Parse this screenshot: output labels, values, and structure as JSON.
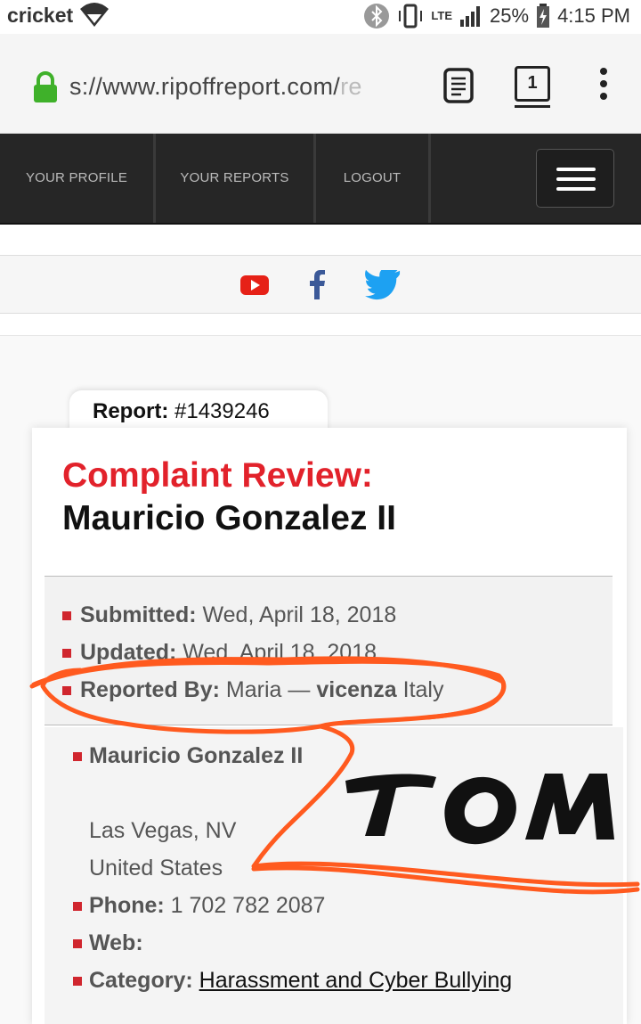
{
  "status_bar": {
    "carrier": "cricket",
    "network": "LTE",
    "battery": "25%",
    "time": "4:15 PM"
  },
  "address_bar": {
    "url_prefix": "s://www.ripoffreport.com/",
    "url_fade": "re",
    "tab_count": "1"
  },
  "nav": {
    "items": [
      "YOUR PROFILE",
      "YOUR REPORTS",
      "LOGOUT"
    ]
  },
  "social": {
    "icons": [
      "youtube-icon",
      "facebook-icon",
      "twitter-icon"
    ],
    "colors": {
      "youtube": "#e62117",
      "facebook": "#3b5998",
      "twitter": "#1da1f2"
    }
  },
  "report": {
    "label": "Report:",
    "number": "#1439246",
    "title_prefix": "Complaint Review:",
    "title_name": "Mauricio Gonzalez II",
    "submitted_label": "Submitted:",
    "submitted_value": "Wed, April 18, 2018",
    "updated_label": "Updated:",
    "updated_value": "Wed, April 18, 2018",
    "reported_by_label": "Reported By:",
    "reported_by_name": "Maria —",
    "reported_by_city": "vicenza",
    "reported_by_country": "Italy"
  },
  "subject": {
    "name": "Mauricio Gonzalez II",
    "city_state": "Las Vegas, NV",
    "country": "United States",
    "phone_label": "Phone:",
    "phone_value": "1 702 782 2087",
    "web_label": "Web:",
    "category_label": "Category:",
    "category_value": "Harassment and Cyber Bullying"
  },
  "annotation": {
    "handwritten_text": "TOM",
    "color": "#ff5a1f"
  },
  "colors": {
    "accent_red": "#e2222b",
    "nav_bg": "#262626"
  }
}
